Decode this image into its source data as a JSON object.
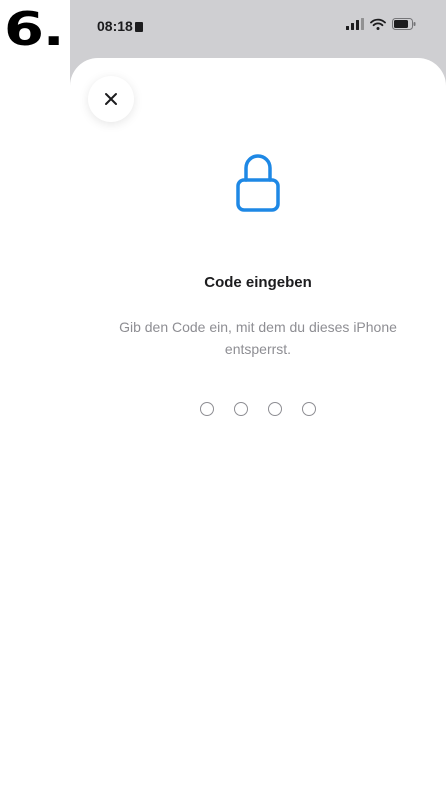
{
  "step": {
    "number": "6."
  },
  "status_bar": {
    "time": "08:18",
    "icons": [
      "signal-icon",
      "wifi-icon",
      "battery-icon"
    ]
  },
  "sheet": {
    "close_icon": "close-icon",
    "lock_icon": "lock-icon",
    "title": "Code eingeben",
    "subtitle": "Gib den Code ein, mit dem du dieses iPhone entsperrst.",
    "code_length": 4
  },
  "colors": {
    "accent": "#1e88e5",
    "text_primary": "#1c1c1e",
    "text_secondary": "#8e8e93",
    "backdrop": "#cfcfd2"
  }
}
